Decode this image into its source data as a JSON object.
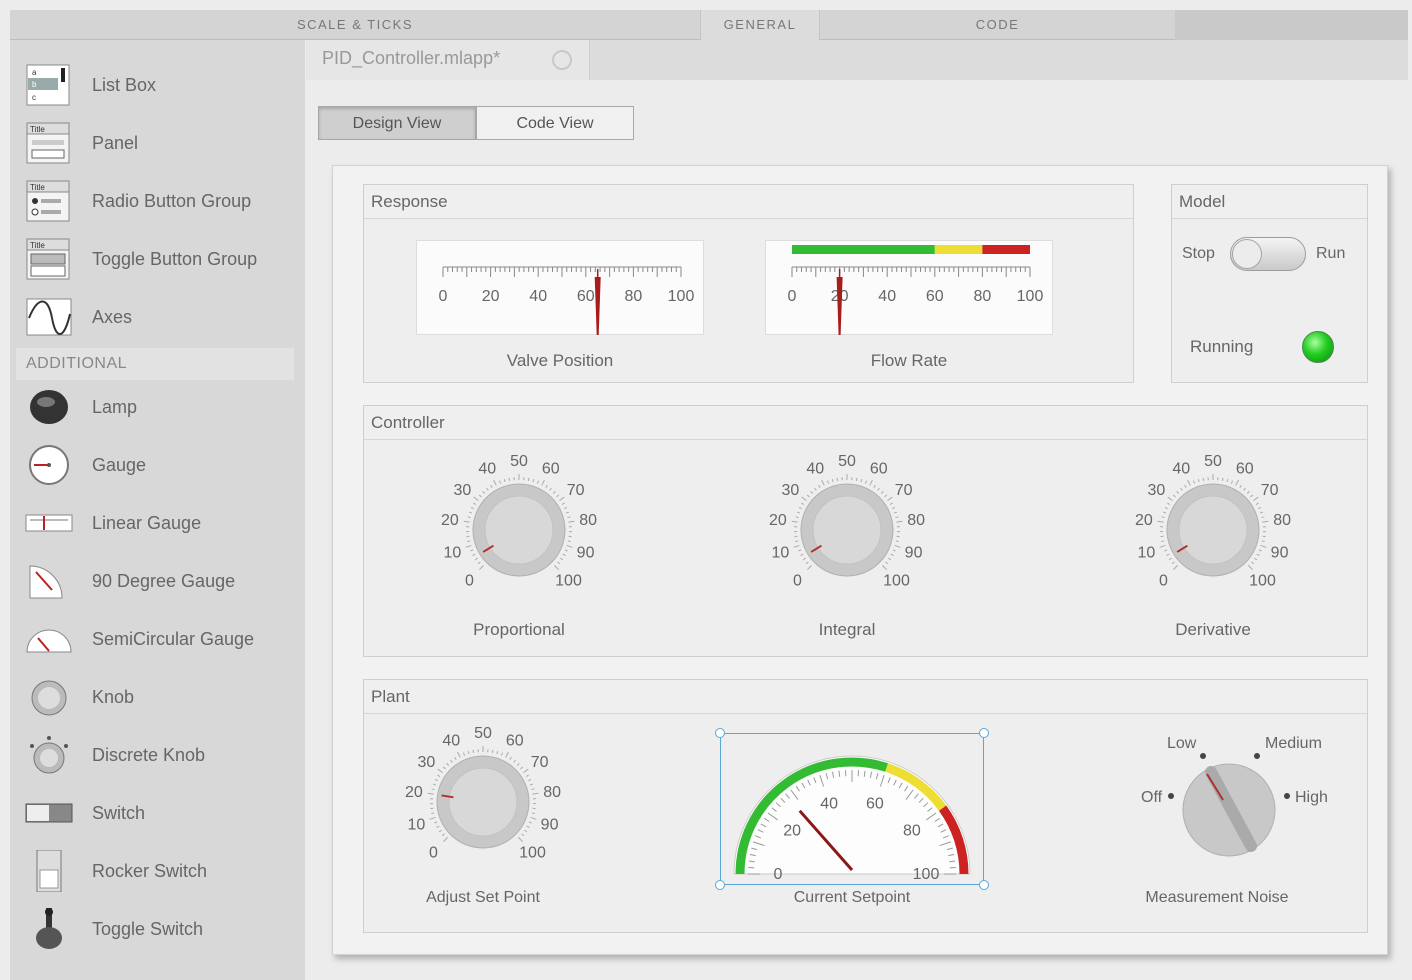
{
  "tabs": [
    "SCALE & TICKS",
    "GENERAL",
    "CODE"
  ],
  "sidebar": {
    "items": [
      {
        "label": "List Box",
        "icon": "list-box-icon"
      },
      {
        "label": "Panel",
        "icon": "panel-icon"
      },
      {
        "label": "Radio Button Group",
        "icon": "radio-button-group-icon"
      },
      {
        "label": "Toggle Button Group",
        "icon": "toggle-button-group-icon"
      },
      {
        "label": "Axes",
        "icon": "axes-icon"
      }
    ],
    "section_label": "ADDITIONAL",
    "additional_items": [
      {
        "label": "Lamp",
        "icon": "lamp-icon"
      },
      {
        "label": "Gauge",
        "icon": "gauge-icon"
      },
      {
        "label": "Linear Gauge",
        "icon": "linear-gauge-icon"
      },
      {
        "label": "90 Degree Gauge",
        "icon": "ninety-degree-gauge-icon"
      },
      {
        "label": "SemiCircular Gauge",
        "icon": "semicircular-gauge-icon"
      },
      {
        "label": "Knob",
        "icon": "knob-icon"
      },
      {
        "label": "Discrete Knob",
        "icon": "discrete-knob-icon"
      },
      {
        "label": "Switch",
        "icon": "switch-icon"
      },
      {
        "label": "Rocker Switch",
        "icon": "rocker-switch-icon"
      },
      {
        "label": "Toggle Switch",
        "icon": "toggle-switch-icon"
      }
    ]
  },
  "file_tab": {
    "name": "PID_Controller.mlapp*"
  },
  "views": {
    "design": "Design View",
    "code": "Code View"
  },
  "response": {
    "title": "Response",
    "valve": {
      "label": "Valve Position",
      "ticks": [
        "0",
        "20",
        "40",
        "60",
        "80",
        "100"
      ],
      "value": 65
    },
    "flow": {
      "label": "Flow Rate",
      "ticks": [
        "0",
        "20",
        "40",
        "60",
        "80",
        "100"
      ],
      "value": 20,
      "bands": [
        "#33bb33",
        "#eedd33",
        "#cc2222"
      ]
    }
  },
  "model": {
    "title": "Model",
    "switch_off": "Stop",
    "switch_on": "Run",
    "lamp_label": "Running",
    "lamp_color": "#22cc22"
  },
  "controller": {
    "title": "Controller",
    "knobs": [
      {
        "label": "Proportional",
        "value": 5
      },
      {
        "label": "Integral",
        "value": 5
      },
      {
        "label": "Derivative",
        "value": 5
      }
    ],
    "knob_ticks": [
      "0",
      "10",
      "20",
      "30",
      "40",
      "50",
      "60",
      "70",
      "80",
      "90",
      "100"
    ]
  },
  "plant": {
    "title": "Plant",
    "setpoint_knob": {
      "label": "Adjust Set Point",
      "value": 20
    },
    "gauge": {
      "label": "Current Setpoint",
      "ticks": [
        "0",
        "20",
        "40",
        "60",
        "80",
        "100"
      ],
      "value": 28,
      "bands": [
        "#33bb33",
        "#eedd33",
        "#cc2222"
      ]
    },
    "discrete": {
      "label": "Measurement Noise",
      "options": [
        "Off",
        "Low",
        "Medium",
        "High"
      ],
      "selected": "Low"
    }
  }
}
